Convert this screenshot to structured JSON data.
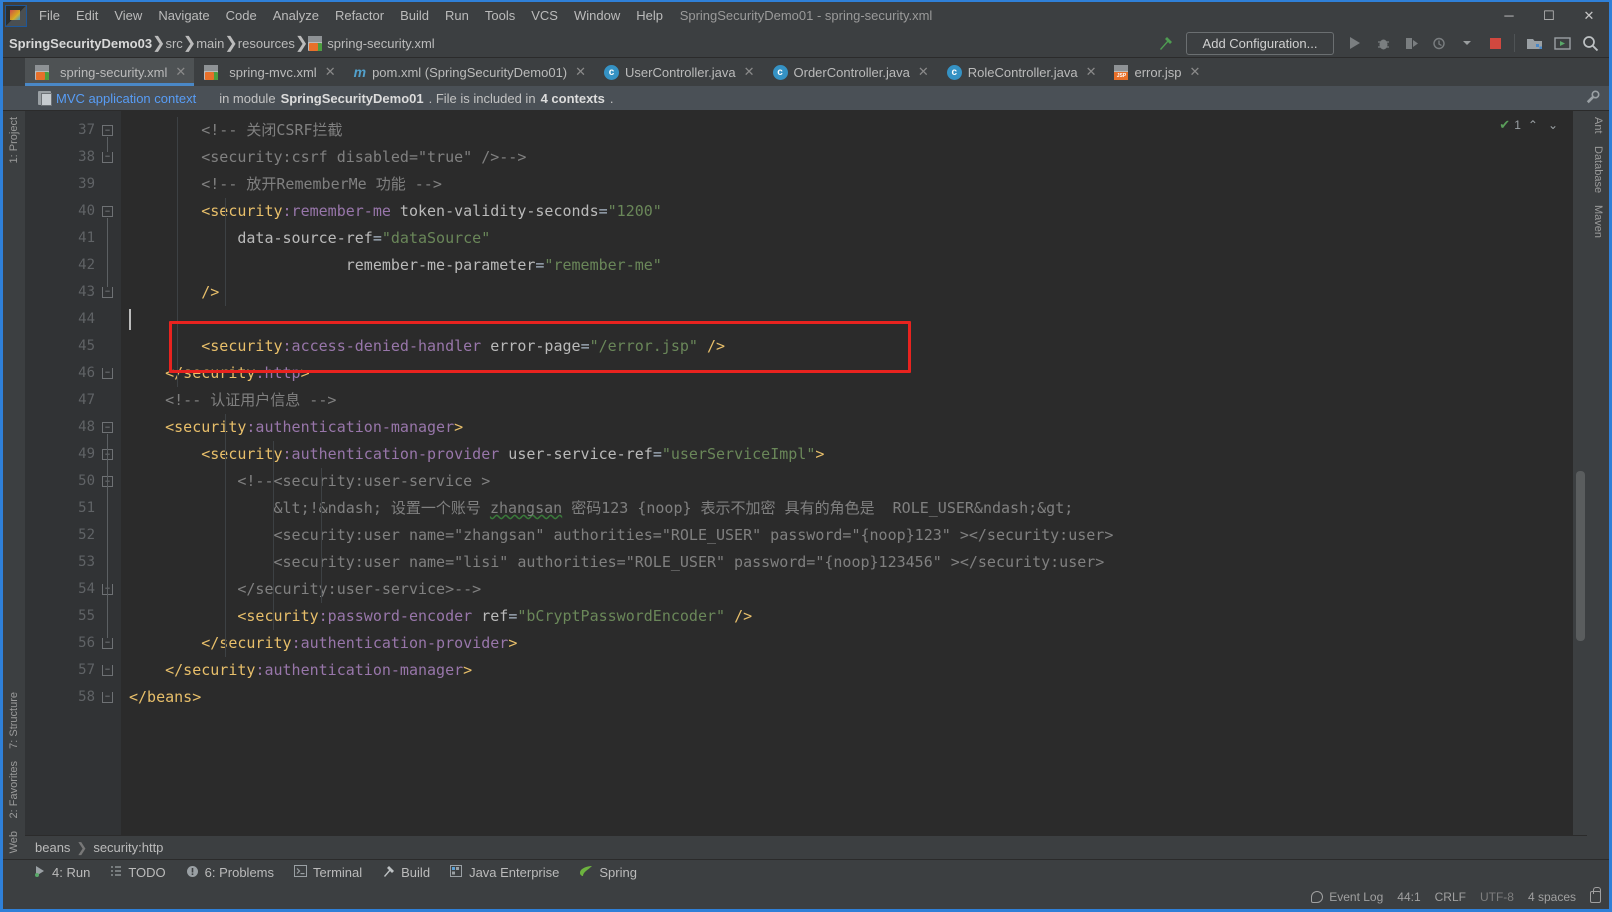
{
  "window": {
    "title": "SpringSecurityDemo01 - spring-security.xml",
    "minimize": "─",
    "maximize": "☐",
    "close": "✕"
  },
  "menu": {
    "items": [
      "File",
      "Edit",
      "View",
      "Navigate",
      "Code",
      "Analyze",
      "Refactor",
      "Build",
      "Run",
      "Tools",
      "VCS",
      "Window",
      "Help"
    ]
  },
  "navbar": {
    "breadcrumb": [
      "SpringSecurityDemo03",
      "src",
      "main",
      "resources",
      "spring-security.xml"
    ],
    "add_configuration": "Add Configuration...",
    "icons": [
      "hammer-build-icon",
      "run-icon",
      "debug-icon",
      "run-coverage-icon",
      "profile-icon",
      "dropdown-arrow-icon",
      "stop-icon",
      "project-structure-icon",
      "updates-icon",
      "search-everywhere-icon"
    ]
  },
  "tabs": [
    {
      "label": "spring-security.xml",
      "icon": "xml-file-icon",
      "active": true
    },
    {
      "label": "spring-mvc.xml",
      "icon": "xml-file-icon",
      "active": false
    },
    {
      "label": "pom.xml (SpringSecurityDemo01)",
      "icon": "maven-file-icon",
      "active": false
    },
    {
      "label": "UserController.java",
      "icon": "java-class-icon",
      "active": false
    },
    {
      "label": "OrderController.java",
      "icon": "java-class-icon",
      "active": false
    },
    {
      "label": "RoleController.java",
      "icon": "java-class-icon",
      "active": false
    },
    {
      "label": "error.jsp",
      "icon": "jsp-file-icon",
      "active": false
    }
  ],
  "context_bar": {
    "link": "MVC application context",
    "text_before": "in module",
    "module": "SpringSecurityDemo01",
    "text_middle": ". File is included in",
    "count": "4 contexts",
    "text_after": ".",
    "wrench": "wrench-icon"
  },
  "inspections": {
    "check_mark": "✔",
    "count": "1",
    "up": "⌃",
    "down": "⌄"
  },
  "editor": {
    "first_line": 37,
    "caret_line_index": 7,
    "lines": [
      {
        "n": 37,
        "fold": "minus",
        "tokens": [
          {
            "c": "t-cmt",
            "t": "        <!-- 关闭CSRF拦截"
          }
        ]
      },
      {
        "n": 38,
        "fold": "minus-end",
        "tokens": [
          {
            "c": "t-cmt",
            "t": "        <security:csrf disabled=\"true\" />-->"
          }
        ]
      },
      {
        "n": 39,
        "fold": "",
        "tokens": [
          {
            "c": "t-cmt",
            "t": "        <!-- 放开RememberMe 功能 -->"
          }
        ]
      },
      {
        "n": 40,
        "fold": "minus",
        "tokens": [
          {
            "c": "t-tag",
            "t": "        <security"
          },
          {
            "c": "t-ns",
            "t": ":remember-me"
          },
          {
            "c": "t-attr",
            "t": " token-validity-seconds"
          },
          {
            "c": "t-punc",
            "t": "="
          },
          {
            "c": "t-str",
            "t": "\"1200\""
          }
        ]
      },
      {
        "n": 41,
        "fold": "",
        "tokens": [
          {
            "c": "t-attr",
            "t": "            data-source-ref"
          },
          {
            "c": "t-punc",
            "t": "="
          },
          {
            "c": "t-str",
            "t": "\"dataSource\""
          }
        ]
      },
      {
        "n": 42,
        "fold": "",
        "tokens": [
          {
            "c": "t-attr",
            "t": "                        remember-me-parameter"
          },
          {
            "c": "t-punc",
            "t": "="
          },
          {
            "c": "t-str",
            "t": "\"remember-me\""
          }
        ]
      },
      {
        "n": 43,
        "fold": "minus-end",
        "tokens": [
          {
            "c": "t-tag",
            "t": "        />"
          }
        ]
      },
      {
        "n": 44,
        "fold": "",
        "tokens": [
          {
            "c": "t-plain",
            "t": ""
          }
        ]
      },
      {
        "n": 45,
        "fold": "",
        "tokens": [
          {
            "c": "t-tag",
            "t": "        <security"
          },
          {
            "c": "t-ns",
            "t": ":access-denied-handler"
          },
          {
            "c": "t-attr",
            "t": " error-page"
          },
          {
            "c": "t-punc",
            "t": "="
          },
          {
            "c": "t-str",
            "t": "\"/error.jsp\""
          },
          {
            "c": "t-tag",
            "t": " />"
          }
        ]
      },
      {
        "n": 46,
        "fold": "minus-end",
        "tokens": [
          {
            "c": "t-tag",
            "t": "    </security"
          },
          {
            "c": "t-ns",
            "t": ":http"
          },
          {
            "c": "t-tag",
            "t": ">"
          }
        ]
      },
      {
        "n": 47,
        "fold": "",
        "tokens": [
          {
            "c": "t-cmt",
            "t": "    <!-- 认证用户信息 -->"
          }
        ]
      },
      {
        "n": 48,
        "fold": "minus",
        "tokens": [
          {
            "c": "t-tag",
            "t": "    <security"
          },
          {
            "c": "t-ns",
            "t": ":authentication-manager"
          },
          {
            "c": "t-tag",
            "t": ">"
          }
        ]
      },
      {
        "n": 49,
        "fold": "minus",
        "tokens": [
          {
            "c": "t-tag",
            "t": "        <security"
          },
          {
            "c": "t-ns",
            "t": ":authentication-provider"
          },
          {
            "c": "t-attr",
            "t": " user-service-ref"
          },
          {
            "c": "t-punc",
            "t": "="
          },
          {
            "c": "t-str",
            "t": "\"userServiceImpl\""
          },
          {
            "c": "t-tag",
            "t": ">"
          }
        ]
      },
      {
        "n": 50,
        "fold": "minus",
        "tokens": [
          {
            "c": "t-cmt",
            "t": "            <!--<security:user-service >"
          }
        ]
      },
      {
        "n": 51,
        "fold": "",
        "tokens": [
          {
            "c": "t-cmt",
            "t": "                &lt;!&ndash; 设置一个账号 "
          },
          {
            "c": "t-cmt typo",
            "t": "zhangsan"
          },
          {
            "c": "t-cmt",
            "t": " 密码123 {noop} 表示不加密 具有的角色是  ROLE_USER&ndash;&gt;"
          }
        ]
      },
      {
        "n": 52,
        "fold": "",
        "tokens": [
          {
            "c": "t-cmt",
            "t": "                <security:user name=\"zhangsan\" authorities=\"ROLE_USER\" password=\"{noop}123\" ></security:user>"
          }
        ]
      },
      {
        "n": 53,
        "fold": "",
        "tokens": [
          {
            "c": "t-cmt",
            "t": "                <security:user name=\"lisi\" authorities=\"ROLE_USER\" password=\"{noop}123456\" ></security:user>"
          }
        ]
      },
      {
        "n": 54,
        "fold": "minus-end",
        "tokens": [
          {
            "c": "t-cmt",
            "t": "            </security:user-service>-->"
          }
        ]
      },
      {
        "n": 55,
        "fold": "",
        "tokens": [
          {
            "c": "t-tag",
            "t": "            <security"
          },
          {
            "c": "t-ns",
            "t": ":password-encoder"
          },
          {
            "c": "t-attr",
            "t": " ref"
          },
          {
            "c": "t-punc",
            "t": "="
          },
          {
            "c": "t-str",
            "t": "\"bCryptPasswordEncoder\""
          },
          {
            "c": "t-tag",
            "t": " />"
          }
        ]
      },
      {
        "n": 56,
        "fold": "minus-end",
        "tokens": [
          {
            "c": "t-tag",
            "t": "        </security"
          },
          {
            "c": "t-ns",
            "t": ":authentication-provider"
          },
          {
            "c": "t-tag",
            "t": ">"
          }
        ]
      },
      {
        "n": 57,
        "fold": "minus-end",
        "tokens": [
          {
            "c": "t-tag",
            "t": "    </security"
          },
          {
            "c": "t-ns",
            "t": ":authentication-manager"
          },
          {
            "c": "t-tag",
            "t": ">"
          }
        ]
      },
      {
        "n": 58,
        "fold": "minus-end",
        "tokens": [
          {
            "c": "t-tag",
            "t": "</beans"
          },
          {
            "c": "t-tag",
            "t": ">"
          }
        ]
      }
    ],
    "highlight_box": {
      "label": "access-denied-handler-highlight",
      "color": "#e8231f"
    }
  },
  "editor_breadcrumb": [
    "beans",
    "security:http"
  ],
  "left_strip": [
    {
      "label": "1: Project",
      "icon": "project-icon"
    },
    {
      "label": "7: Structure",
      "icon": "structure-icon"
    },
    {
      "label": "2: Favorites",
      "icon": "star-icon"
    },
    {
      "label": "Web",
      "icon": "web-icon"
    }
  ],
  "right_strip": [
    {
      "label": "Ant",
      "icon": "ant-icon"
    },
    {
      "label": "Database",
      "icon": "database-icon"
    },
    {
      "label": "Maven",
      "icon": "maven-icon"
    }
  ],
  "bottom_tools": [
    {
      "label": "4: Run",
      "icon": "run-icon"
    },
    {
      "label": "TODO",
      "icon": "todo-icon"
    },
    {
      "label": "6: Problems",
      "icon": "problems-icon"
    },
    {
      "label": "Terminal",
      "icon": "terminal-icon"
    },
    {
      "label": "Build",
      "icon": "build-hammer-icon"
    },
    {
      "label": "Java Enterprise",
      "icon": "java-enterprise-icon"
    },
    {
      "label": "Spring",
      "icon": "spring-leaf-icon"
    }
  ],
  "status": {
    "event_log": "Event Log",
    "position": "44:1",
    "line_separator": "CRLF",
    "encoding": "UTF-8",
    "indent": "4 spaces",
    "lock": "lock-icon"
  },
  "colors": {
    "accent_blue": "#2f80d8",
    "tab_underline": "#4a88c7",
    "editor_bg": "#2b2b2b",
    "panel_bg": "#3c3f41",
    "highlight_red": "#e8231f",
    "link_blue": "#589df6"
  }
}
